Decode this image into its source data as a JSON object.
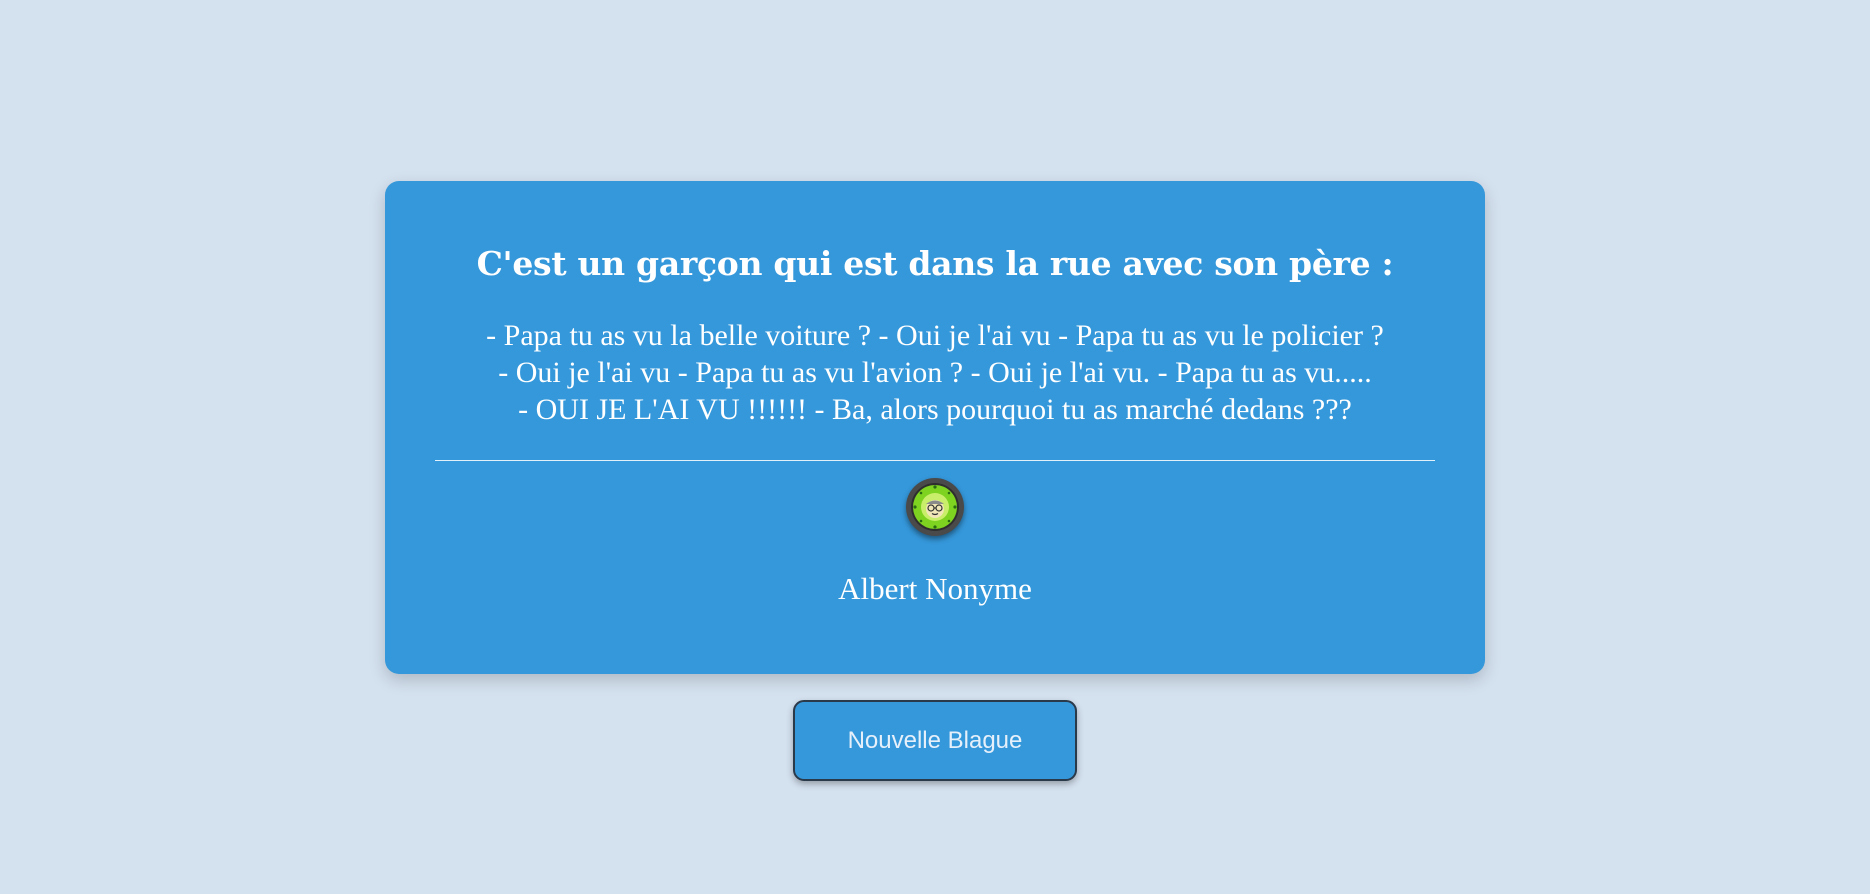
{
  "joke": {
    "title": "C'est un garçon qui est dans la rue avec son père :",
    "body_lines": [
      "- Papa tu as vu la belle voiture ? - Oui je l'ai vu - Papa tu as vu le policier ?",
      "- Oui je l'ai vu - Papa tu as vu l'avion ? - Oui je l'ai vu. - Papa tu as vu.....",
      "- OUI JE L'AI VU !!!!!! - Ba, alors pourquoi tu as marché dedans ???"
    ],
    "author": "Albert Nonyme",
    "avatar_icon": "smiley-face-with-glasses-icon"
  },
  "actions": {
    "new_joke_label": "Nouvelle Blague"
  },
  "colors": {
    "background": "#d4e1ef",
    "card": "#3598db",
    "text": "#ffffff",
    "avatar_green": "#7ed321"
  }
}
